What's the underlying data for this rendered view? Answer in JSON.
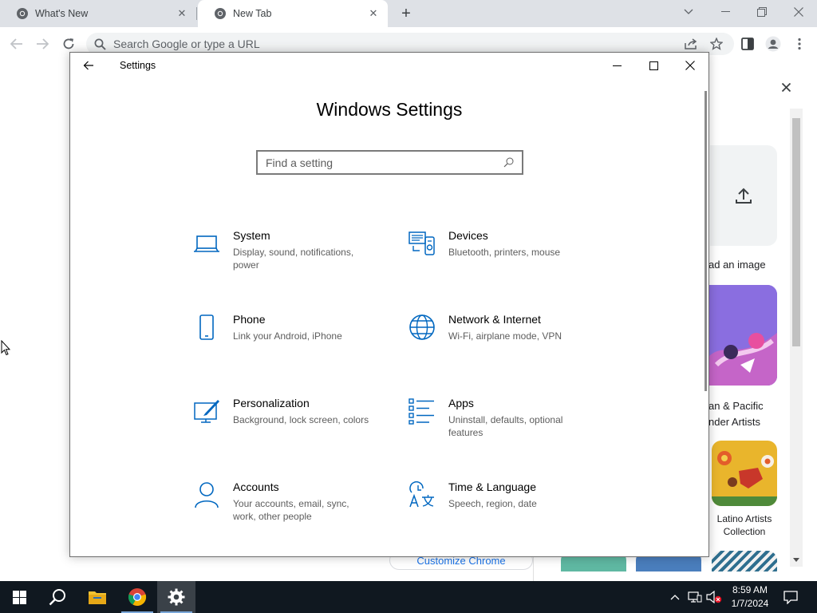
{
  "browser": {
    "tabs": [
      {
        "title": "What's New",
        "close": "✕"
      },
      {
        "title": "New Tab",
        "close": "✕"
      }
    ],
    "new_tab": "+",
    "omnibox_placeholder": "Search Google or type a URL",
    "panel": {
      "upload_label": "ad an image",
      "collection_1": [
        "an & Pacific",
        "nder Artists"
      ],
      "collection_2": [
        "Latino Artists",
        "Collection"
      ]
    },
    "customize_label": "Customize Chrome"
  },
  "settings": {
    "app_title": "Settings",
    "heading": "Windows Settings",
    "search_placeholder": "Find a setting",
    "categories": [
      {
        "title": "System",
        "desc": "Display, sound, notifications, power",
        "icon": "laptop-icon"
      },
      {
        "title": "Devices",
        "desc": "Bluetooth, printers, mouse",
        "icon": "devices-icon"
      },
      {
        "title": "Phone",
        "desc": "Link your Android, iPhone",
        "icon": "phone-icon"
      },
      {
        "title": "Network & Internet",
        "desc": "Wi-Fi, airplane mode, VPN",
        "icon": "globe-icon"
      },
      {
        "title": "Personalization",
        "desc": "Background, lock screen, colors",
        "icon": "personalization-icon"
      },
      {
        "title": "Apps",
        "desc": "Uninstall, defaults, optional features",
        "icon": "apps-icon"
      },
      {
        "title": "Accounts",
        "desc": "Your accounts, email, sync, work, other people",
        "icon": "person-icon"
      },
      {
        "title": "Time & Language",
        "desc": "Speech, region, date",
        "icon": "time-language-icon"
      }
    ]
  },
  "taskbar": {
    "time": "8:59 AM",
    "date": "1/7/2024"
  },
  "colors": {
    "accent": "#0067c0",
    "chrome_tabstrip": "#dee1e6",
    "taskbar": "#101820"
  }
}
